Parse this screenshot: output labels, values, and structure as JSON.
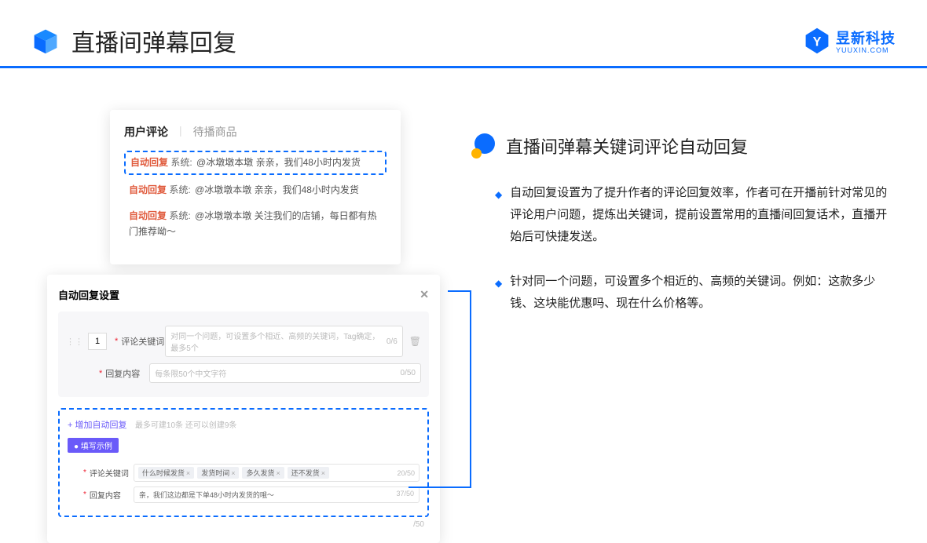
{
  "header": {
    "title": "直播间弹幕回复",
    "logo_text": "昱新科技",
    "logo_sub": "YUUXIN.COM"
  },
  "card1": {
    "tab_active": "用户评论",
    "tab_inactive": "待播商品",
    "msg1_tag": "自动回复",
    "msg1_sys": "系统:",
    "msg1_txt": "@冰墩墩本墩 亲亲，我们48小时内发货",
    "msg2_tag": "自动回复",
    "msg2_sys": "系统:",
    "msg2_txt": "@冰墩墩本墩 亲亲，我们48小时内发货",
    "msg3_tag": "自动回复",
    "msg3_sys": "系统:",
    "msg3_txt": "@冰墩墩本墩 关注我们的店铺，每日都有热门推荐呦～"
  },
  "card2": {
    "title": "自动回复设置",
    "num": "1",
    "kw_label": "评论关键词",
    "kw_placeholder": "对同一个问题，可设置多个相近、高频的关键词，Tag确定，最多5个",
    "kw_count": "0/6",
    "content_label": "回复内容",
    "content_placeholder": "每条限50个中文字符",
    "content_count": "0/50",
    "add_link": "+ 增加自动回复",
    "add_hint": "最多可建10条 还可以创建9条",
    "example_badge": "● 填写示例",
    "ex_kw_label": "评论关键词",
    "tag1": "什么时候发货",
    "tag2": "发货时间",
    "tag3": "多久发货",
    "tag4": "还不发货",
    "ex_kw_count": "20/50",
    "ex_content_label": "回复内容",
    "ex_content_txt": "亲，我们这边都是下单48小时内发货的哦～",
    "ex_content_count": "37/50",
    "outer_count": "/50"
  },
  "right": {
    "title": "直播间弹幕关键词评论自动回复",
    "bullet1": "自动回复设置为了提升作者的评论回复效率，作者可在开播前针对常见的评论用户问题，提炼出关键词，提前设置常用的直播间回复话术，直播开始后可快捷发送。",
    "bullet2": "针对同一个问题，可设置多个相近的、高频的关键词。例如：这款多少钱、这块能优惠吗、现在什么价格等。"
  }
}
